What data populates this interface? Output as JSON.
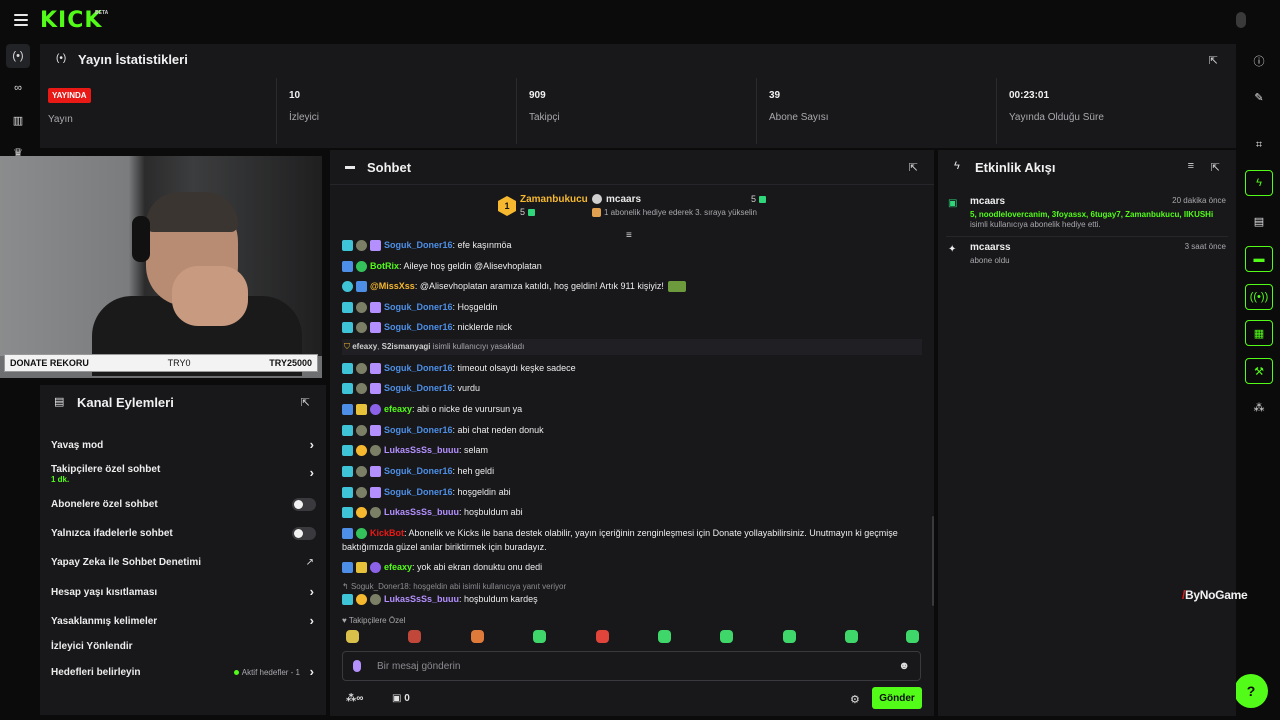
{
  "brand": {
    "logo": "KICK",
    "beta": "BETA",
    "accent": "#53fc18"
  },
  "stats": {
    "title": "Yayın İstatistikleri",
    "live_badge": "YAYINDA",
    "cells": [
      {
        "value": "",
        "label": "Yayın"
      },
      {
        "value": "10",
        "label": "İzleyici"
      },
      {
        "value": "909",
        "label": "Takipçi"
      },
      {
        "value": "39",
        "label": "Abone Sayısı"
      },
      {
        "value": "00:23:01",
        "label": "Yayında Olduğu Süre"
      }
    ]
  },
  "video": {
    "donate_left": "DONATE REKORU",
    "donate_mid": "TRY0",
    "donate_right": "TRY25000"
  },
  "channel_actions": {
    "title": "Kanal Eylemleri",
    "items": [
      {
        "label": "Yavaş mod"
      },
      {
        "label": "Takipçilere özel sohbet",
        "sub": "1 dk."
      },
      {
        "label": "Abonelere özel sohbet"
      },
      {
        "label": "Yalnızca ifadelerle sohbet"
      },
      {
        "label": "Yapay Zeka ile Sohbet Denetimi"
      },
      {
        "label": "Hesap yaşı kısıtlaması"
      },
      {
        "label": "Yasaklanmış kelimeler"
      },
      {
        "label": "İzleyici Yönlendir"
      },
      {
        "label": "Hedefleri belirleyin",
        "status": "Aktif hedefler - 1"
      }
    ]
  },
  "chat": {
    "title": "Sohbet",
    "leaderboard": [
      {
        "rank": "1",
        "name": "Zamanbukucu",
        "count": "5",
        "color": "#f5b82e"
      },
      {
        "rank": "",
        "name": "mcaars",
        "count": "5",
        "sub": "1 abonelik hediye ederek 3. sıraya yükselin",
        "color": "#ededed"
      }
    ],
    "messages": [
      {
        "user": "Soguk_Doner16",
        "color": "#4d8fe6",
        "text": ": efe kaşınmöa",
        "badges": [
          "b-cyan",
          "b-gray",
          "b-purple"
        ]
      },
      {
        "user": "BotRix",
        "color": "#53fc18",
        "text": ": Aileye hoş geldin @Alisevhoplatan",
        "badges": [
          "b-blue",
          "b-green"
        ]
      },
      {
        "user": "@MissXss",
        "color": "#f5b82e",
        "text": ": @Alisevhoplatan aramıza katıldı, hoş geldin! Artık 911 kişiyiz!",
        "badges": [
          "b-cyan",
          "b-blue"
        ]
      },
      {
        "user": "Soguk_Doner16",
        "color": "#4d8fe6",
        "text": ": Hoşgeldin",
        "badges": [
          "b-cyan",
          "b-gray",
          "b-purple"
        ]
      },
      {
        "user": "Soguk_Doner16",
        "color": "#4d8fe6",
        "text": ": nicklerde nick",
        "badges": [
          "b-cyan",
          "b-gray",
          "b-purple"
        ]
      },
      {
        "system": true,
        "user": "efeaxy",
        "user2": "S2ismanyagi",
        "text": " isimli kullanıcıyı yasakladı"
      },
      {
        "user": "Soguk_Doner16",
        "color": "#4d8fe6",
        "text": ": timeout olsaydı keşke sadece",
        "badges": [
          "b-cyan",
          "b-gray",
          "b-purple"
        ]
      },
      {
        "user": "Soguk_Doner16",
        "color": "#4d8fe6",
        "text": ": vurdu",
        "badges": [
          "b-cyan",
          "b-gray",
          "b-purple"
        ]
      },
      {
        "user": "efeaxy",
        "color": "#53fc18",
        "text": ": abi o nicke de vurursun ya",
        "badges": [
          "b-blue",
          "b-crown",
          "b-violet"
        ]
      },
      {
        "user": "Soguk_Doner16",
        "color": "#4d8fe6",
        "text": ": abi chat neden donuk",
        "badges": [
          "b-cyan",
          "b-gray",
          "b-purple"
        ]
      },
      {
        "user": "LukasSsSs_buuu",
        "color": "#b490ff",
        "text": ": selam",
        "badges": [
          "b-cyan",
          "b-gold",
          "b-gray"
        ]
      },
      {
        "user": "Soguk_Doner16",
        "color": "#4d8fe6",
        "text": ": heh geldi",
        "badges": [
          "b-cyan",
          "b-gray",
          "b-purple"
        ]
      },
      {
        "user": "Soguk_Doner16",
        "color": "#4d8fe6",
        "text": ": hoşgeldin abi",
        "badges": [
          "b-cyan",
          "b-gray",
          "b-purple"
        ]
      },
      {
        "user": "LukasSsSs_buuu",
        "color": "#b490ff",
        "text": ": hoşbuldum abi",
        "badges": [
          "b-cyan",
          "b-gold",
          "b-gray"
        ]
      },
      {
        "user": "KickBot",
        "color": "#e91916",
        "text": ": Abonelik ve Kicks ile bana destek olabilir, yayın içeriğinin zenginleşmesi için Donate yollayabilirsiniz. Unutmayın ki geçmişe",
        "text2": "baktığımızda güzel anılar biriktirmek için buradayız.",
        "badges": [
          "b-blue",
          "b-green"
        ]
      },
      {
        "user": "efeaxy",
        "color": "#53fc18",
        "text": ": yok abi ekran donuktu onu dedi",
        "badges": [
          "b-blue",
          "b-crown",
          "b-violet"
        ]
      },
      {
        "reply_to": "Soguk_Doner18: hoşgeldin abi isimli kullanıcıya yanıt veriyor",
        "user": "LukasSsSs_buuu",
        "color": "#b490ff",
        "text": ": hoşbuldum kardeş",
        "badges": [
          "b-cyan",
          "b-gold",
          "b-gray"
        ]
      }
    ],
    "emote_section_label": "Takipçilere Özel",
    "emote_colors": [
      "#d9c04a",
      "#c0473a",
      "#e07a3a",
      "#3fd66a",
      "#e0443a",
      "#3fd66a",
      "#3fd66a",
      "#3fd66a",
      "#3fd66a",
      "#3fd66a"
    ],
    "input_placeholder": "Bir mesaj gönderin",
    "points": "∞",
    "gift_count": "0",
    "send_label": "Gönder"
  },
  "activity": {
    "title": "Etkinlik Akışı",
    "items": [
      {
        "user": "mcaars",
        "time": "20 dakika önce",
        "gifted": "5, noodlelovercanim, 3foyassx, 6tugay7, Zamanbukucu, IIKUSHi",
        "text": "isimli kullanıcıya abonelik hediye etti."
      },
      {
        "user": "mcaarss",
        "time": "3 saat önce",
        "text": "abone oldu"
      }
    ]
  },
  "watermark": {
    "mark": "/",
    "text": "ByNoGame"
  }
}
